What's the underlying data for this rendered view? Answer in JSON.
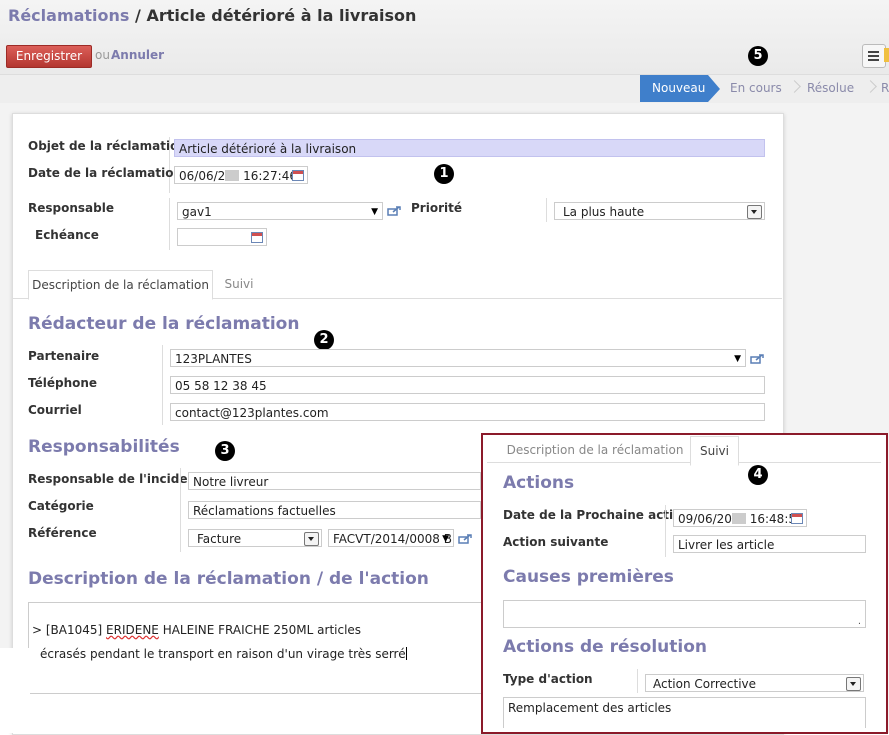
{
  "breadcrumb": {
    "parent": "Réclamations",
    "sep": " / ",
    "current": "Article détérioré à la livraison"
  },
  "toolbar": {
    "save_label": "Enregistrer",
    "or_label": "ou",
    "cancel_label": "Annuler"
  },
  "statusbar": {
    "stages": [
      "Nouveau",
      "En cours",
      "Résolue",
      "R"
    ],
    "active": "Nouveau"
  },
  "callouts": [
    "1",
    "2",
    "3",
    "4",
    "5"
  ],
  "header_fields": {
    "object_label": "Objet de la réclamation",
    "object_value": "Article détérioré à la livraison",
    "date_label": "Date de la réclamation",
    "date_value_start": "06/06/2",
    "date_value_end": "16:27:46",
    "responsible_label": "Responsable",
    "responsible_value": "gav1",
    "priority_label": "Priorité",
    "priority_value": "La plus haute",
    "deadline_label": "Echéance",
    "deadline_value": ""
  },
  "tabs": [
    {
      "label": "Description de la réclamation"
    },
    {
      "label": "Suivi"
    }
  ],
  "author_section": {
    "title": "Rédacteur de la réclamation",
    "partner_label": "Partenaire",
    "partner_value": "123PLANTES",
    "phone_label": "Téléphone",
    "phone_value": "05 58 12 38 45",
    "email_label": "Courriel",
    "email_value": "contact@123plantes.com"
  },
  "resp_section": {
    "title": "Responsabilités",
    "incident_label": "Responsable de l'incident",
    "incident_value": "Notre livreur",
    "category_label": "Catégorie",
    "category_value": "Réclamations factuelles",
    "ref_label": "Référence",
    "ref_type": "Facture",
    "ref_value": "FACVT/2014/0008 B"
  },
  "desc_section": {
    "title": "Description de la réclamation / de l'action",
    "line1_prefix": "> [BA1045] ",
    "line1_word": "ERIDENE",
    "line1_rest": " HALEINE FRAICHE 250ML articles",
    "line2": "écrasés pendant le transport en raison d'un virage très serré"
  },
  "inset": {
    "tab_desc": "Description de la réclamation",
    "tab_followup": "Suivi",
    "actions_title": "Actions",
    "next_date_label": "Date de la Prochaine action",
    "next_date_start": "09/06/20",
    "next_date_end": "16:48:58",
    "next_action_label": "Action suivante",
    "next_action_value": "Livrer les article",
    "root_causes_title": "Causes premières",
    "root_causes_value": ".",
    "resolution_title": "Actions de résolution",
    "action_type_label": "Type d'action",
    "action_type_value": "Action Corrective",
    "resolution_text": "Remplacement des articles"
  },
  "colors": {
    "accent": "#7c7bad",
    "save": "#c9423c",
    "active_stage": "#3f7fcb",
    "highlight_input": "#d8d8f8",
    "inset_border": "#8b1a2a"
  }
}
